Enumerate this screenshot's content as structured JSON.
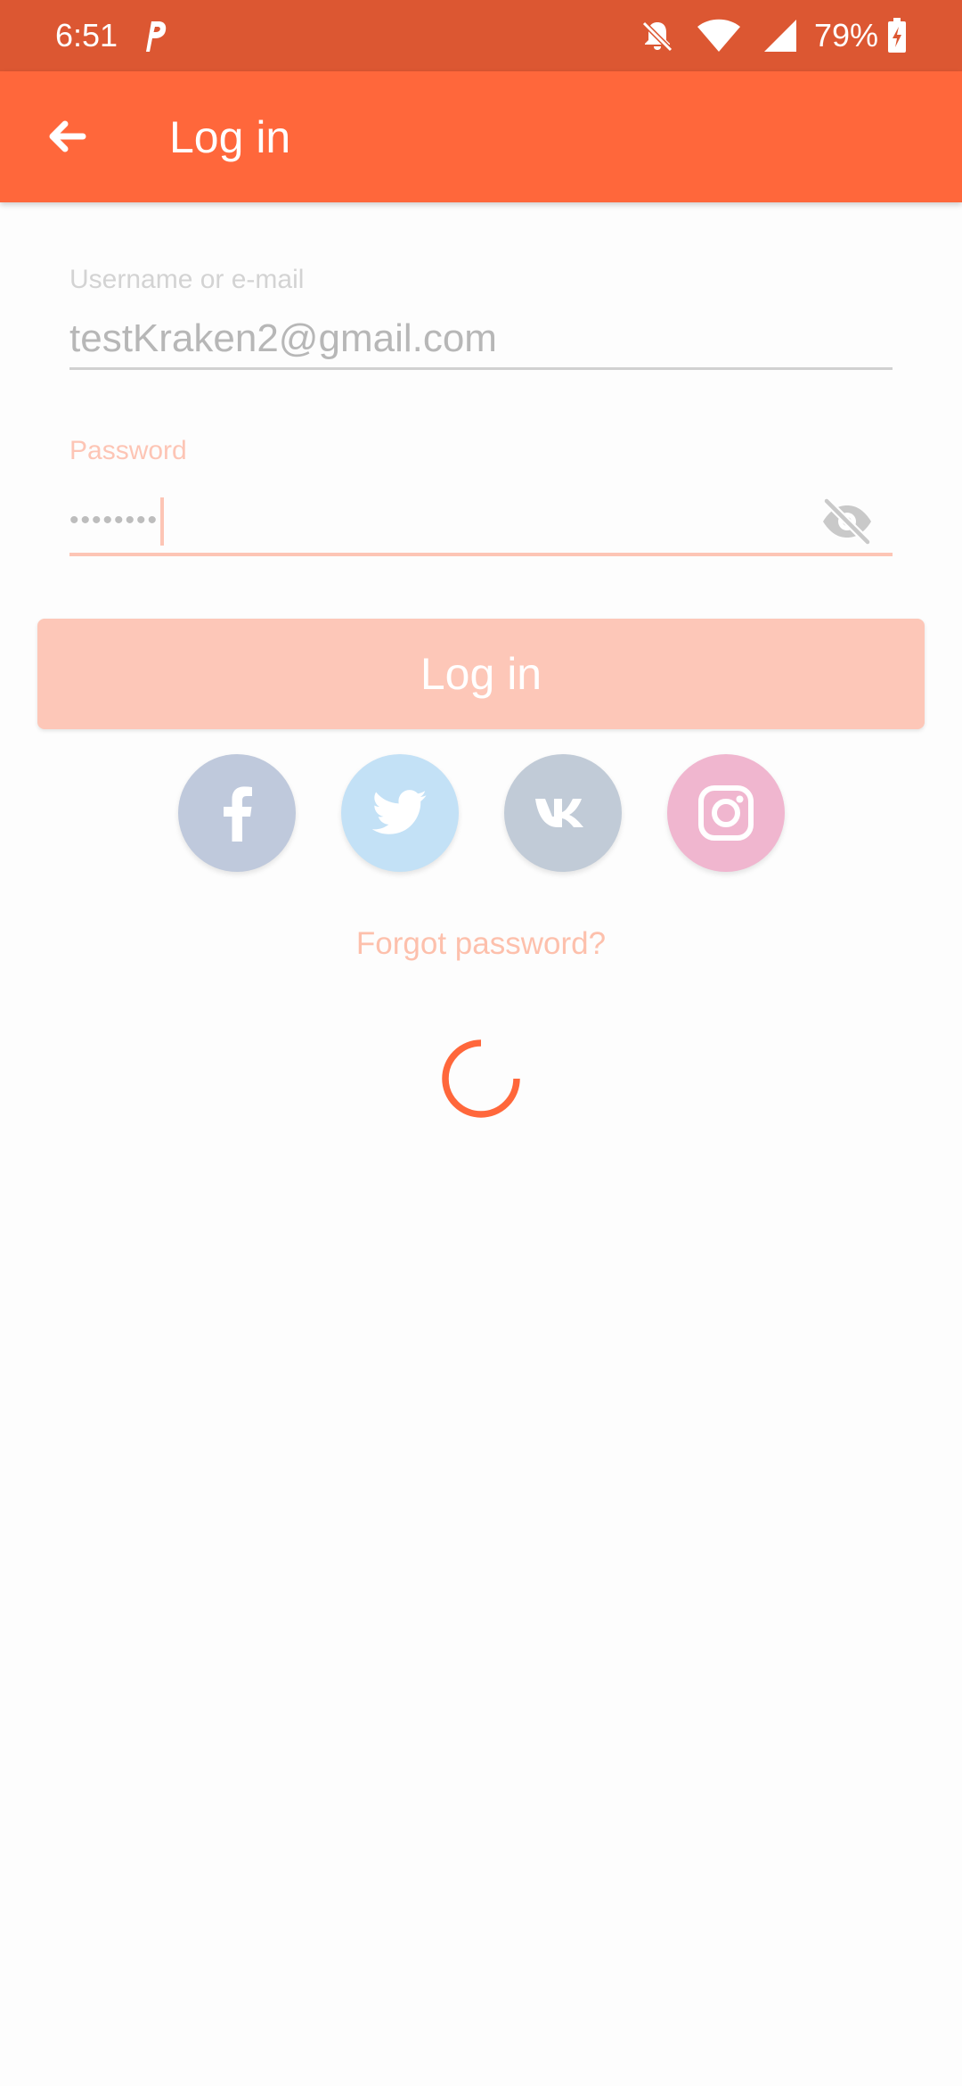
{
  "status_bar": {
    "time": "6:51",
    "battery": "79%",
    "icons": [
      "parking-p-icon",
      "bell-off-icon",
      "wifi-icon",
      "signal-icon",
      "battery-charging-icon"
    ]
  },
  "app_bar": {
    "back_icon": "arrow-left-icon",
    "title": "Log in"
  },
  "form": {
    "username": {
      "label": "Username or e-mail",
      "value": "testKraken2@gmail.com"
    },
    "password": {
      "label": "Password",
      "masked_value": "••••••••",
      "toggle_icon": "eye-off-icon"
    },
    "login_button": "Log in"
  },
  "social_login": {
    "providers": [
      {
        "name": "facebook",
        "icon": "facebook-icon",
        "color": "#bfc9dc"
      },
      {
        "name": "twitter",
        "icon": "twitter-icon",
        "color": "#c3e1f6"
      },
      {
        "name": "vk",
        "icon": "vk-icon",
        "color": "#c1cbd7"
      },
      {
        "name": "instagram",
        "icon": "instagram-icon",
        "color": "#f0b6cf"
      }
    ]
  },
  "forgot_password": "Forgot password?",
  "colors": {
    "status_bar": "#dc5732",
    "app_bar": "#ff673b",
    "accent": "#ff673b",
    "login_button_disabled": "#fdc7b8"
  }
}
